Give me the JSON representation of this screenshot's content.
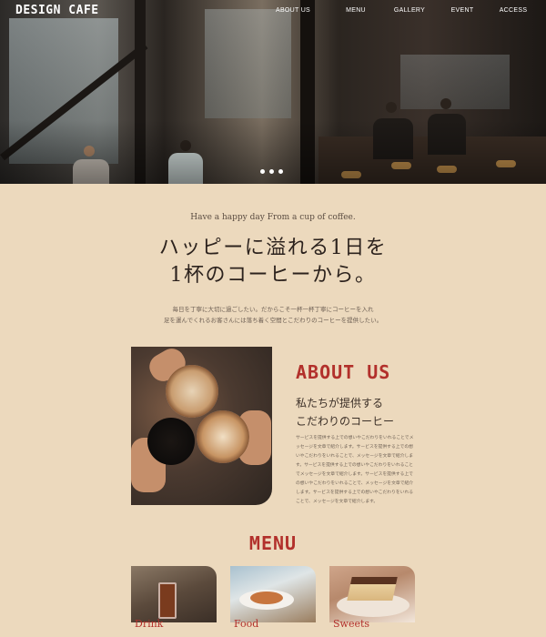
{
  "brand": {
    "logo": "DESIGN CAFE"
  },
  "nav": {
    "items": [
      "ABOUT US",
      "MENU",
      "GALLERY",
      "EVENT",
      "ACCESS"
    ]
  },
  "hero": {
    "slides": 3
  },
  "intro": {
    "tagline": "Have a happy day From a cup of coffee.",
    "headline_line1": "ハッピーに溢れる1日を",
    "headline_line2": "1杯のコーヒーから。",
    "desc_line1": "毎日を丁寧に大切に過ごしたい。だからこそ一杯一杯丁寧にコーヒーを入れ",
    "desc_line2": "足を運んでくれるお客さんには落ち着く空間とこだわりのコーヒーを提供したい。"
  },
  "about": {
    "title": "ABOUT US",
    "subtitle_line1": "私たちが提供する",
    "subtitle_line2": "こだわりのコーヒー",
    "body": "サービスを提供する上での想いやこだわりをいれることでメッセージを文章で紹介します。サービスを提供する上での想いやこだわりをいれることで、メッセージを文章で紹介します。サービスを提供する上での想いやこだわりをいれることでメッセージを文章で紹介します。サービスを提供する上での想いやこだわりをいれることで、メッセージを文章で紹介します。サービスを提供する上での想いやこだわりをいれることで、メッセージを文章で紹介します。"
  },
  "menu": {
    "title": "MENU",
    "cards": [
      {
        "label": "Drink"
      },
      {
        "label": "Food"
      },
      {
        "label": "Sweets"
      }
    ]
  },
  "colors": {
    "background": "#ecd9bd",
    "accent": "#b2302b",
    "text": "#3b2f27"
  }
}
